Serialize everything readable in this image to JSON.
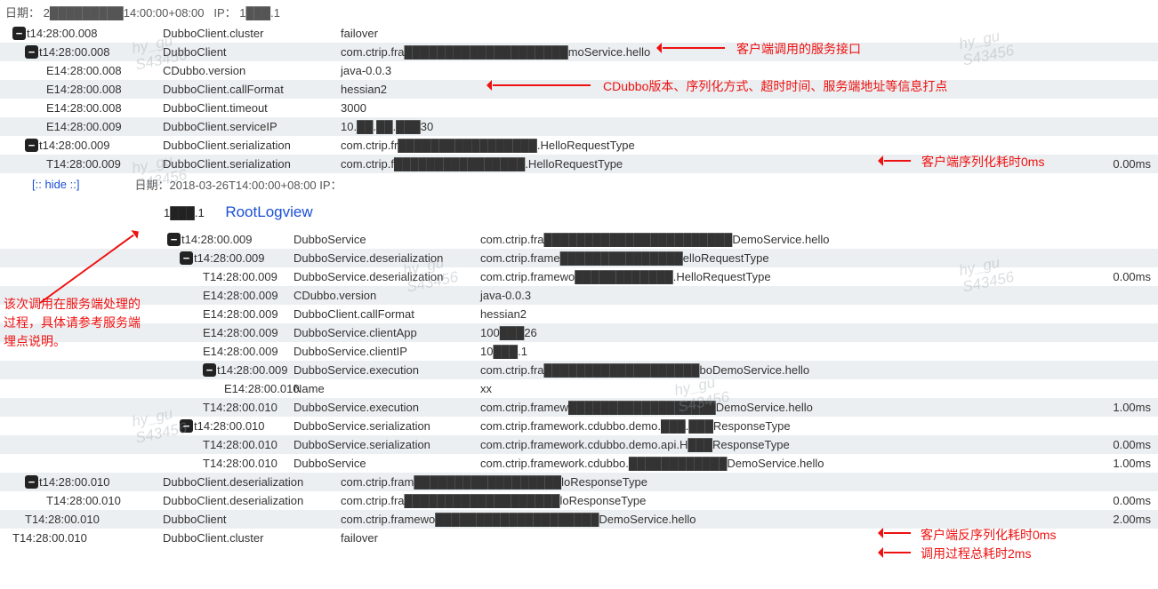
{
  "header": {
    "date_label": "日期：",
    "date_value": "2█████████14:00:00+08:00",
    "ip_label": "IP：",
    "ip_value": "1███.1"
  },
  "hide_link": "[:: hide ::]",
  "sub_header": {
    "text": "日期：2018-03-26T14:00:00+08:00 IP："
  },
  "ip_line": {
    "ip": "1███.1",
    "rootlog": "RootLogview"
  },
  "rows1": [
    {
      "toggle": true,
      "indent": 0,
      "time": "t14:28:00.008",
      "name": "DubboClient.cluster",
      "value": "failover",
      "ms": "",
      "alt": false
    },
    {
      "toggle": true,
      "indent": 1,
      "time": "t14:28:00.008",
      "name": "DubboClient",
      "value": "com.ctrip.fra████████████████████moService.hello",
      "ms": "",
      "alt": true
    },
    {
      "toggle": false,
      "indent": 2,
      "time": "E14:28:00.008",
      "name": "CDubbo.version",
      "value": "java-0.0.3",
      "ms": "",
      "alt": false
    },
    {
      "toggle": false,
      "indent": 2,
      "time": "E14:28:00.008",
      "name": "DubboClient.callFormat",
      "value": "hessian2",
      "ms": "",
      "alt": true
    },
    {
      "toggle": false,
      "indent": 2,
      "time": "E14:28:00.008",
      "name": "DubboClient.timeout",
      "value": "3000",
      "ms": "",
      "alt": false
    },
    {
      "toggle": false,
      "indent": 2,
      "time": "E14:28:00.009",
      "name": "DubboClient.serviceIP",
      "value": "10.██.██.███30",
      "ms": "",
      "alt": true
    },
    {
      "toggle": true,
      "indent": 1,
      "time": "t14:28:00.009",
      "name": "DubboClient.serialization",
      "value": "com.ctrip.fr█████████████████.HelloRequestType",
      "ms": "",
      "alt": false
    },
    {
      "toggle": false,
      "indent": 2,
      "time": "T14:28:00.009",
      "name": "DubboClient.serialization",
      "value": "com.ctrip.f████████████████.HelloRequestType",
      "ms": "0.00ms",
      "alt": true
    }
  ],
  "rows2": [
    {
      "toggle": true,
      "indent": 0,
      "time": "t14:28:00.009",
      "name": "DubboService",
      "value": "com.ctrip.fra███████████████████████DemoService.hello",
      "ms": "",
      "alt": false
    },
    {
      "toggle": true,
      "indent": 1,
      "time": "t14:28:00.009",
      "name": "DubboService.deserialization",
      "value": "com.ctrip.frame███████████████elloRequestType",
      "ms": "",
      "alt": true
    },
    {
      "toggle": false,
      "indent": 2,
      "time": "T14:28:00.009",
      "name": "DubboService.deserialization",
      "value": "com.ctrip.framewo████████████.HelloRequestType",
      "ms": "0.00ms",
      "alt": false
    },
    {
      "toggle": false,
      "indent": 2,
      "time": "E14:28:00.009",
      "name": "CDubbo.version",
      "value": "java-0.0.3",
      "ms": "",
      "alt": true
    },
    {
      "toggle": false,
      "indent": 2,
      "time": "E14:28:00.009",
      "name": "DubboClient.callFormat",
      "value": "hessian2",
      "ms": "",
      "alt": false
    },
    {
      "toggle": false,
      "indent": 2,
      "time": "E14:28:00.009",
      "name": "DubboService.clientApp",
      "value": "100███26",
      "ms": "",
      "alt": true
    },
    {
      "toggle": false,
      "indent": 2,
      "time": "E14:28:00.009",
      "name": "DubboService.clientIP",
      "value": "10███.1",
      "ms": "",
      "alt": false
    },
    {
      "toggle": true,
      "indent": 2,
      "time": "t14:28:00.009",
      "name": "DubboService.execution",
      "value": "com.ctrip.fra███████████████████boDemoService.hello",
      "ms": "",
      "alt": true
    },
    {
      "toggle": false,
      "indent": 3,
      "time": "E14:28:00.010",
      "name": "Name",
      "value": "xx",
      "ms": "",
      "alt": false
    },
    {
      "toggle": false,
      "indent": 2,
      "time": "T14:28:00.010",
      "name": "DubboService.execution",
      "value": "com.ctrip.framew██████████████████DemoService.hello",
      "ms": "1.00ms",
      "alt": true
    },
    {
      "toggle": true,
      "indent": 1,
      "time": "t14:28:00.010",
      "name": "DubboService.serialization",
      "value": "com.ctrip.framework.cdubbo.demo.███.███ResponseType",
      "ms": "",
      "alt": false
    },
    {
      "toggle": false,
      "indent": 2,
      "time": "T14:28:00.010",
      "name": "DubboService.serialization",
      "value": "com.ctrip.framework.cdubbo.demo.api.H███ResponseType",
      "ms": "0.00ms",
      "alt": true
    },
    {
      "toggle": false,
      "indent": 2,
      "time": "T14:28:00.010",
      "name": "DubboService",
      "value": "com.ctrip.framework.cdubbo.████████████DemoService.hello",
      "ms": "1.00ms",
      "alt": false
    }
  ],
  "rows3": [
    {
      "toggle": true,
      "indent": 1,
      "time": "t14:28:00.010",
      "name": "DubboClient.deserialization",
      "value": "com.ctrip.fram██████████████████loResponseType",
      "ms": "",
      "alt": true
    },
    {
      "toggle": false,
      "indent": 2,
      "time": "T14:28:00.010",
      "name": "DubboClient.deserialization",
      "value": "com.ctrip.fra███████████████████loResponseType",
      "ms": "0.00ms",
      "alt": false
    },
    {
      "toggle": false,
      "indent": 1,
      "time": "T14:28:00.010",
      "name": "DubboClient",
      "value": "com.ctrip.framewo████████████████████DemoService.hello",
      "ms": "2.00ms",
      "alt": true
    },
    {
      "toggle": false,
      "indent": 0,
      "time": "T14:28:00.010",
      "name": "DubboClient.cluster",
      "value": "failover",
      "ms": "",
      "alt": false
    }
  ],
  "annotations": {
    "a1": "客户端调用的服务接口",
    "a2": "CDubbo版本、序列化方式、超时时间、服务端地址等信息打点",
    "a3": "客户端序列化耗时0ms",
    "a4": "该次调用在服务端处理的过程，具体请参考服务端埋点说明。",
    "a5": "客户端反序列化耗时0ms",
    "a6": "调用过程总耗时2ms"
  },
  "watermark": {
    "line1": "hy_gu",
    "line2": "S43456"
  }
}
